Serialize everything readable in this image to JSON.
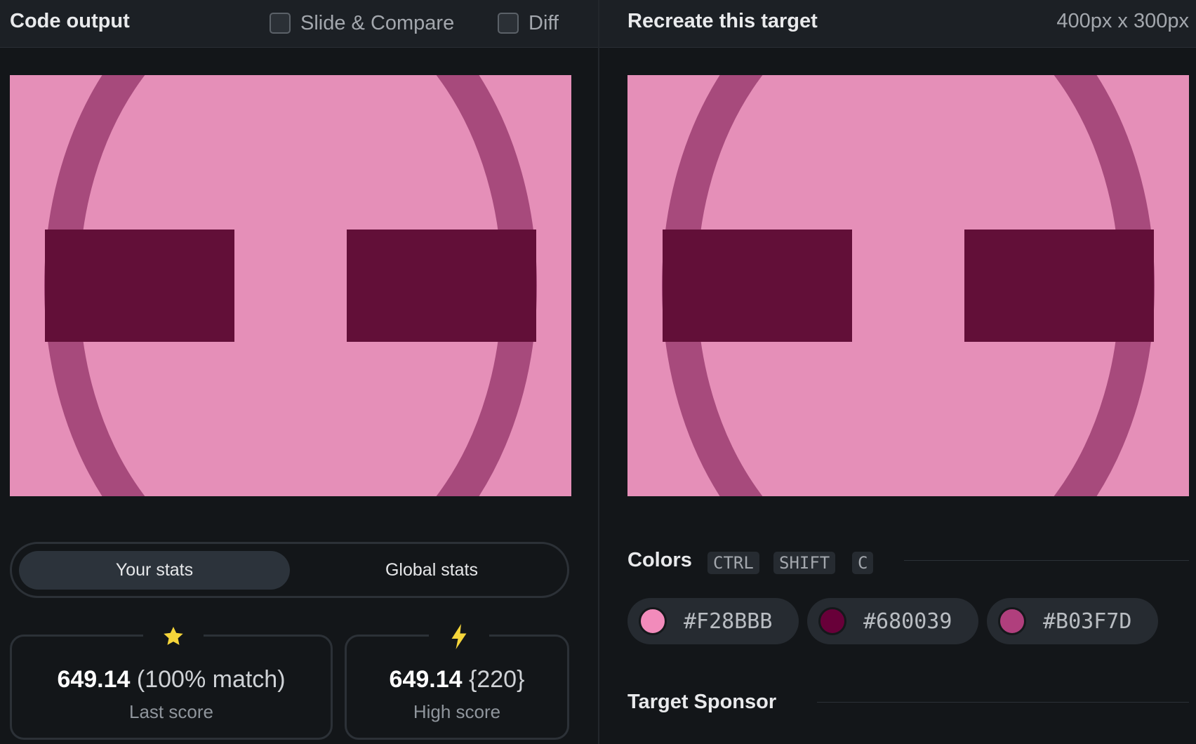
{
  "left": {
    "title": "Code output",
    "toggles": [
      {
        "label": "Slide & Compare",
        "checked": false
      },
      {
        "label": "Diff",
        "checked": false
      }
    ]
  },
  "right": {
    "title": "Recreate this target",
    "dimensions": "400px x 300px"
  },
  "stats": {
    "tabs": [
      {
        "label": "Your stats",
        "active": true
      },
      {
        "label": "Global stats",
        "active": false
      }
    ],
    "last": {
      "icon": "star-icon",
      "value": "649.14",
      "extra": "(100% match)",
      "label": "Last score"
    },
    "high": {
      "icon": "bolt-icon",
      "value": "649.14",
      "extra": "{220}",
      "label": "High score"
    }
  },
  "colors": {
    "title": "Colors",
    "shortcut": [
      "CTRL",
      "SHIFT",
      "C"
    ],
    "swatches": [
      {
        "hex": "#F28BBB"
      },
      {
        "hex": "#680039"
      },
      {
        "hex": "#B03F7D"
      }
    ]
  },
  "sponsor": {
    "title": "Target Sponsor"
  },
  "palette": {
    "background": "#E58FB8",
    "dark": "#620F38",
    "ring": "#A74A7C",
    "accent_yellow": "#F5D53A"
  }
}
